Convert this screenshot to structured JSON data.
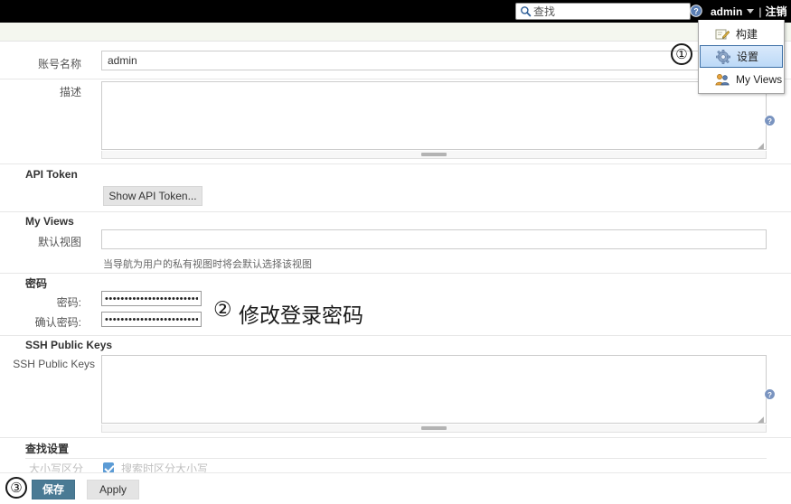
{
  "topbar": {
    "search": {
      "placeholder": "查找",
      "value": "",
      "icon": "search-icon"
    },
    "help_icon": "help-circle-icon",
    "user": "admin",
    "separator": "|",
    "logout": "注销"
  },
  "dropdown": {
    "items": [
      {
        "label": "构建",
        "icon": "build-pencil-icon",
        "selected": false
      },
      {
        "label": "设置",
        "icon": "gear-icon",
        "selected": true
      },
      {
        "label": "My Views",
        "icon": "people-icon",
        "selected": false
      }
    ]
  },
  "form": {
    "account_name": {
      "label": "账号名称",
      "value": "admin"
    },
    "description": {
      "label": "描述",
      "value": "",
      "help_icon": "help-circle-icon"
    },
    "api_token": {
      "section": "API Token",
      "show_button": "Show API Token..."
    },
    "my_views": {
      "section": "My Views",
      "default_view_label": "默认视图",
      "default_view_value": "",
      "hint": "当导航为用户的私有视图时将会默认选择该视图"
    },
    "password": {
      "section": "密码",
      "password_label": "密码:",
      "password_value": "••••••••••••••••••••••••••••••••••",
      "confirm_label": "确认密码:",
      "confirm_value": "••••••••••••••••••••••••••••••"
    },
    "ssh": {
      "section": "SSH Public Keys",
      "label": "SSH Public Keys",
      "value": "",
      "help_icon": "help-circle-icon"
    },
    "search_settings": {
      "section": "查找设置",
      "row_label": "大小写区分",
      "checkbox_label": "搜索时区分大小写",
      "checked": true
    }
  },
  "footer": {
    "save_label": "保存",
    "apply_label": "Apply"
  },
  "annotations": [
    {
      "marker": "①"
    },
    {
      "marker": "②",
      "text": "修改登录密码"
    },
    {
      "marker": "③"
    }
  ],
  "colors": {
    "topbar_bg": "#000000",
    "crumb_bg": "#f4f7ef",
    "save_button": "#4a7a94",
    "apply_button": "#e4e4e4",
    "menu_selected": "#bcd9f7",
    "checkbox": "#5b9bd5"
  }
}
